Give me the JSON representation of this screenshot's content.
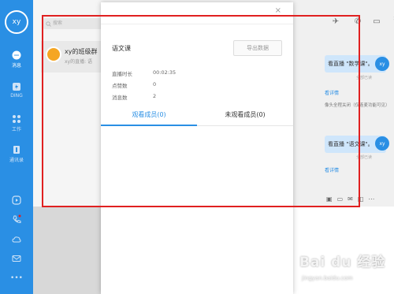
{
  "sidebar": {
    "avatar_text": "xy",
    "items": [
      {
        "label": "消息",
        "icon": "chat-bubble-icon"
      },
      {
        "label": "DING",
        "icon": "ding-icon"
      },
      {
        "label": "工作",
        "icon": "grid-icon"
      },
      {
        "label": "通讯录",
        "icon": "contacts-icon"
      }
    ]
  },
  "search": {
    "placeholder": "搜索"
  },
  "chat_list": [
    {
      "name": "xy的班级群",
      "preview": "xy的直播: 语"
    }
  ],
  "right_pane": {
    "messages": [
      {
        "text": "看直播 \"数学课\"。",
        "read": "全部已读"
      },
      {
        "text": "看直播 \"语文课\"。",
        "read": "全部已读"
      }
    ],
    "link_text": "看详情",
    "system_text": "像头全程关闭（仅连麦功能可见）",
    "avatar_text": "xy"
  },
  "dialog": {
    "course": "语文课",
    "export_label": "导出数据",
    "stats": [
      {
        "key": "直播时长",
        "value": "00:02:35"
      },
      {
        "key": "点赞数",
        "value": "0"
      },
      {
        "key": "消息数",
        "value": "2"
      }
    ],
    "tabs": [
      {
        "label": "观看成员(0)",
        "active": true
      },
      {
        "label": "未观看成员(0)",
        "active": false
      }
    ],
    "close_glyph": "×"
  },
  "watermark": {
    "brand": "Bai du 经验",
    "url": "jingyan.baidu.com"
  },
  "colors": {
    "accent": "#2a8fe4",
    "annotation": "#e02020"
  }
}
